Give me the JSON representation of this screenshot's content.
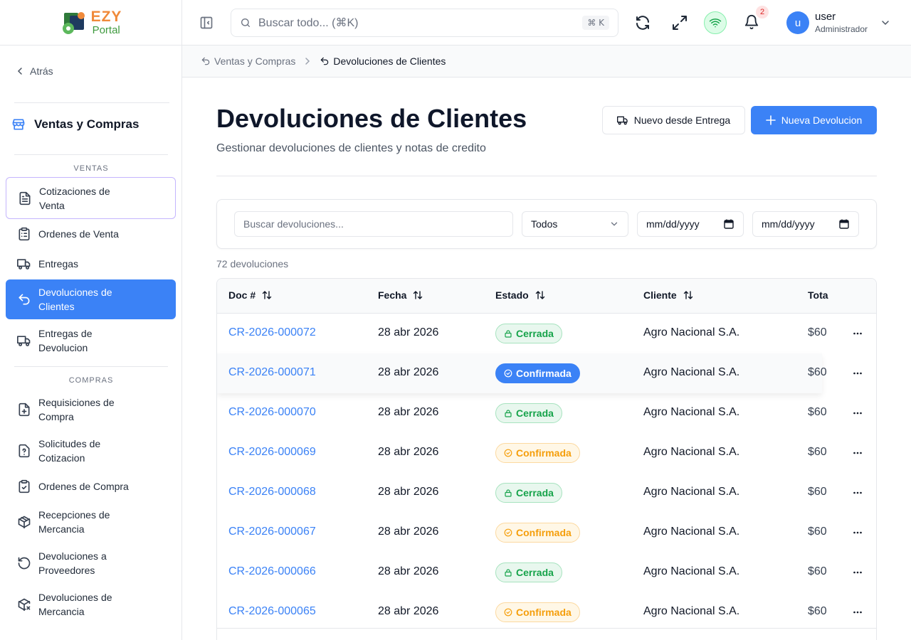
{
  "brand": {
    "top": "EZY",
    "bottom": "Portal"
  },
  "sidebar": {
    "back_label": "Atrás",
    "module_title": "Ventas y Compras",
    "sections": [
      {
        "label": "VENTAS"
      },
      {
        "label": "COMPRAS"
      }
    ],
    "items": [
      {
        "label": "Cotizaciones de Venta",
        "icon": "file-text-icon"
      },
      {
        "label": "Ordenes de Venta",
        "icon": "clipboard-list-icon"
      },
      {
        "label": "Entregas",
        "icon": "truck-icon"
      },
      {
        "label": "Devoluciones de Clientes",
        "icon": "undo-icon",
        "active": true
      },
      {
        "label": "Entregas de Devolucion",
        "icon": "truck-icon"
      },
      {
        "label": "Requisiciones de Compra",
        "icon": "file-plus-icon"
      },
      {
        "label": "Solicitudes de Cotizacion",
        "icon": "file-question-icon"
      },
      {
        "label": "Ordenes de Compra",
        "icon": "clipboard-check-icon"
      },
      {
        "label": "Recepciones de Mercancia",
        "icon": "package-icon"
      },
      {
        "label": "Devoluciones a Proveedores",
        "icon": "rotate-ccw-icon"
      },
      {
        "label": "Devoluciones de Mercancia",
        "icon": "package-x-icon"
      }
    ]
  },
  "topbar": {
    "search_placeholder": "Buscar todo... (⌘K)",
    "search_shortcut": "⌘ K",
    "notifications_count": "2",
    "user": {
      "initial": "u",
      "name": "user",
      "role": "Administrador"
    }
  },
  "breadcrumb": [
    {
      "label": "Ventas y Compras"
    },
    {
      "label": "Devoluciones de Clientes"
    }
  ],
  "page": {
    "title": "Devoluciones de Clientes",
    "subtitle": "Gestionar devoluciones de clientes y notas de credito",
    "btn_from_delivery": "Nuevo desde Entrega",
    "btn_new": "Nueva Devolucion"
  },
  "filters": {
    "search_placeholder": "Buscar devoluciones...",
    "status_value": "Todos",
    "date_from": "mm/dd/yyyy",
    "date_to": "mm/dd/yyyy"
  },
  "count_label": "72 devoluciones",
  "table": {
    "columns": [
      "Doc #",
      "Fecha",
      "Estado",
      "Cliente",
      "Tota"
    ],
    "rows": [
      {
        "doc": "CR-2026-000072",
        "fecha": "28 abr 2026",
        "estado": "Cerrada",
        "cliente": "Agro Nacional S.A.",
        "total": "$60"
      },
      {
        "doc": "CR-2026-000071",
        "fecha": "28 abr 2026",
        "estado": "Confirmada",
        "cliente": "Agro Nacional S.A.",
        "total": "$60"
      },
      {
        "doc": "CR-2026-000070",
        "fecha": "28 abr 2026",
        "estado": "Cerrada",
        "cliente": "Agro Nacional S.A.",
        "total": "$60"
      },
      {
        "doc": "CR-2026-000069",
        "fecha": "28 abr 2026",
        "estado": "Confirmada",
        "cliente": "Agro Nacional S.A.",
        "total": "$60"
      },
      {
        "doc": "CR-2026-000068",
        "fecha": "28 abr 2026",
        "estado": "Cerrada",
        "cliente": "Agro Nacional S.A.",
        "total": "$60"
      },
      {
        "doc": "CR-2026-000067",
        "fecha": "28 abr 2026",
        "estado": "Confirmada",
        "cliente": "Agro Nacional S.A.",
        "total": "$60"
      },
      {
        "doc": "CR-2026-000066",
        "fecha": "28 abr 2026",
        "estado": "Cerrada",
        "cliente": "Agro Nacional S.A.",
        "total": "$60"
      },
      {
        "doc": "CR-2026-000065",
        "fecha": "28 abr 2026",
        "estado": "Confirmada",
        "cliente": "Agro Nacional S.A.",
        "total": "$60"
      }
    ]
  },
  "colors": {
    "accent": "#3b82f6",
    "status_cerrada": "#16a34a",
    "status_confirmada": "#f59e0b",
    "brand_orange": "#f08a3a",
    "brand_green": "#3f9a3f"
  }
}
